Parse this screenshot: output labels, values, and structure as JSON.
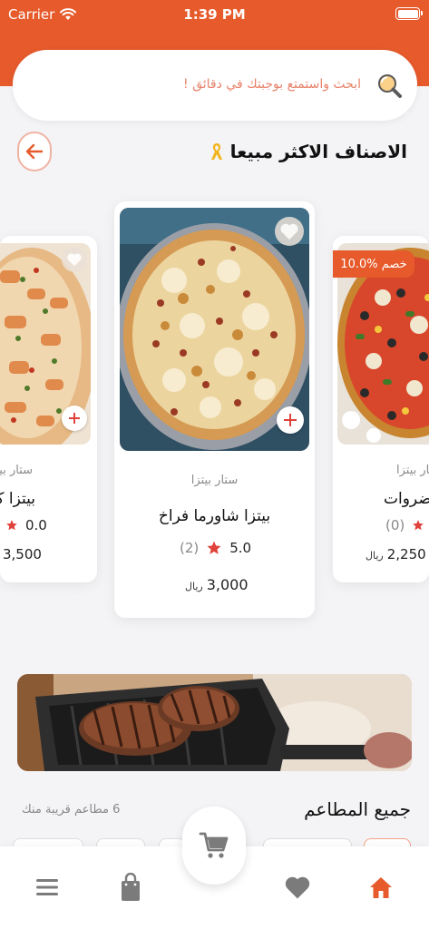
{
  "status_bar": {
    "carrier": "Carrier",
    "time": "1:39 PM"
  },
  "search": {
    "placeholder": "ابحث واستمتع بوجبتك في دقائق !"
  },
  "section": {
    "title": "الاصناف الاكثر مبيعا"
  },
  "products": {
    "left": {
      "store": "ستار بيتزا",
      "name": "بيتزا كوكتيل",
      "rating": "0.0",
      "price": "3,500"
    },
    "center": {
      "store": "ستار بيتزا",
      "name": "بيتزا شاورما فراخ",
      "rating": "5.0",
      "rating_count": "(2)",
      "price": "3,000",
      "currency": "ريال"
    },
    "right": {
      "discount": "10.0% خصم",
      "store": "ستار بيتزا",
      "name": "خضروات",
      "rating_count": "(0)",
      "price": "2,250",
      "currency": "ريال",
      "old_currency": "ر"
    }
  },
  "restaurants": {
    "title": "جميع المطاعم",
    "nearby_count": "6 مطاعم قريبة منك"
  },
  "colors": {
    "brand": "#e65a2b",
    "star": "#e0413a",
    "icon_gray": "#7b7b7b"
  },
  "bottom_nav": {
    "items": [
      "menu-icon",
      "bag-icon",
      "cart-icon",
      "heart-icon",
      "home-icon"
    ],
    "active": "home-icon"
  }
}
